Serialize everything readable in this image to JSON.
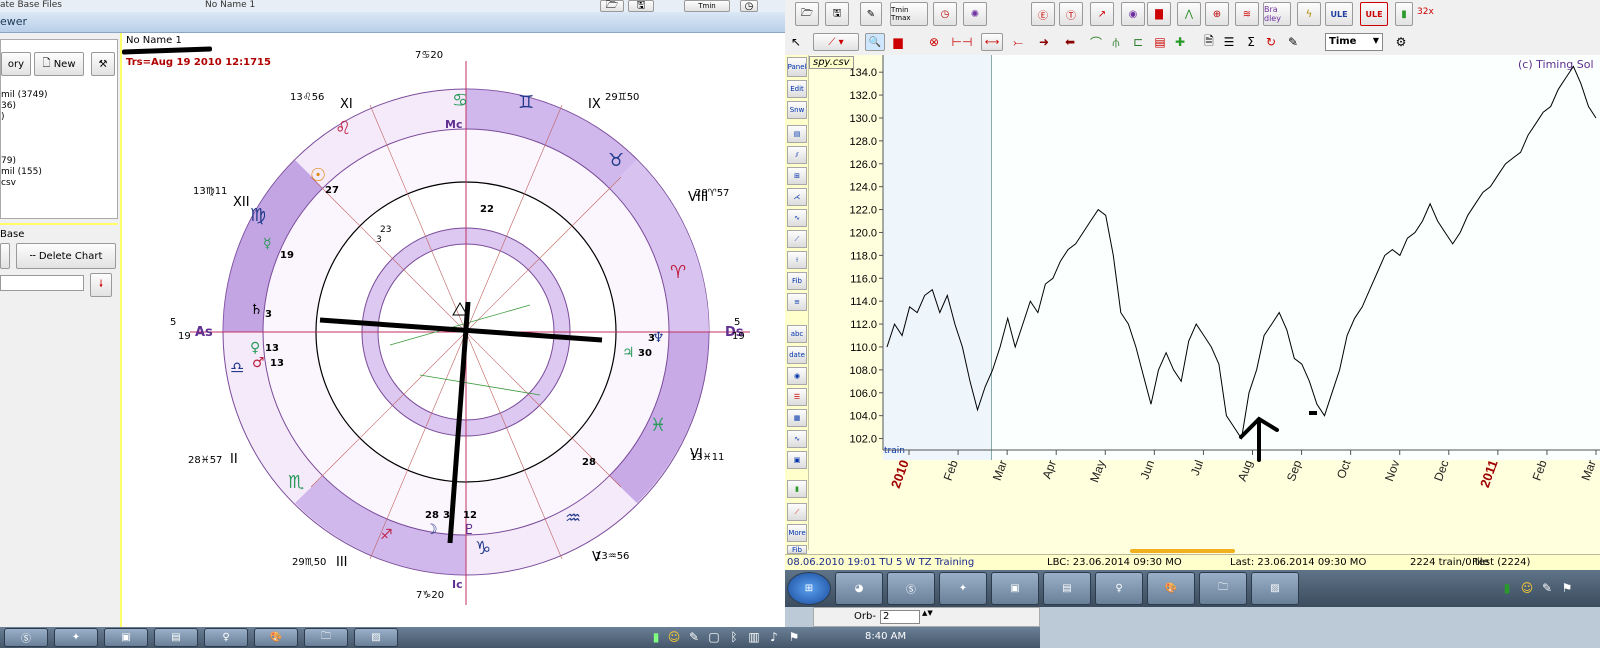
{
  "left_window": {
    "title_fragment": "ewer",
    "top_tabs": [
      "ate Base Files",
      "No Name 1"
    ],
    "panel": {
      "history_button": "ory",
      "new_button": "New",
      "list_items": [
        "mil (3749)",
        "36)",
        ")",
        "79)",
        "mil (155)",
        "csv"
      ],
      "base_label": "Base",
      "delete_button": "Delete Chart"
    },
    "chart_name": "No Name 1",
    "transit_label": "Trs=Aug 19 2010 12:1715"
  },
  "wheel": {
    "houses": [
      "XI",
      "IX",
      "XII",
      "VIII",
      "II",
      "VI",
      "III",
      "V"
    ],
    "axis_labels": {
      "mc": "Mc",
      "ic": "Ic",
      "as": "As",
      "ds": "Ds"
    },
    "degree_labels": [
      "7♋20",
      "13♌56",
      "29♊50",
      "13♍11",
      "28♈57",
      "5",
      "19",
      "5",
      "19",
      "28♓57",
      "13♓11",
      "29♏50",
      "13♒56",
      "7♑20"
    ],
    "planet_numbers": [
      "27",
      "19",
      "3",
      "13",
      "13",
      "30",
      "3",
      "28",
      "3",
      "12",
      "28",
      "22",
      "23",
      "3"
    ]
  },
  "right_app": {
    "time_select": "Time",
    "badges": [
      "ULE",
      "ULE",
      "32x",
      "Bra dley"
    ],
    "chart_title": "spy.csv",
    "copyright": "(c) Timing Sol",
    "train_label": "train",
    "sidebar_labels": [
      "Panel",
      "Edit",
      "Snw",
      "abc",
      "date",
      "More",
      "Fib"
    ],
    "status": {
      "left": "08.06.2010  19:01 TU  5 W TZ  Training",
      "lbc": "LBC: 23.06.2014  09:30 MO",
      "last": "Last: 23.06.2014  09:30 MO",
      "count": "2224 train/0 test (2224)",
      "file": "File"
    }
  },
  "taskbar": {
    "clock": "8:40 AM",
    "orb_label": "Orb-",
    "orb_value": "2"
  },
  "chart_data": {
    "type": "line",
    "yticks": [
      102.0,
      104.0,
      106.0,
      108.0,
      110.0,
      112.0,
      114.0,
      116.0,
      118.0,
      120.0,
      122.0,
      124.0,
      126.0,
      128.0,
      130.0,
      132.0,
      134.0
    ],
    "ylim": [
      101.0,
      135.5
    ],
    "x_labels": [
      "2010",
      "Feb",
      "Mar",
      "Apr",
      "May",
      "Jun",
      "Jul",
      "Aug",
      "Sep",
      "Oct",
      "Nov",
      "Dec",
      "2011",
      "Feb",
      "Mar"
    ],
    "year_labels": [
      "2010",
      "2011"
    ],
    "series": [
      {
        "values": [
          110,
          112,
          111,
          113.5,
          113,
          114.5,
          115,
          113,
          114.5,
          112,
          110,
          107,
          104.5,
          106.5,
          108,
          110,
          112.5,
          110,
          112,
          114,
          113,
          115.5,
          116,
          117.5,
          118.5,
          119,
          120,
          121,
          122,
          121.5,
          118,
          113,
          112,
          110,
          107.5,
          105,
          108,
          109.5,
          108,
          107,
          110.5,
          112,
          111,
          110,
          108.5,
          104,
          103,
          102,
          106,
          108,
          111,
          112,
          113,
          111.5,
          109,
          108.5,
          107,
          105,
          104,
          106,
          108,
          111,
          112.5,
          113.5,
          115,
          116.5,
          118,
          118.5,
          118,
          119.5,
          120,
          121,
          122.5,
          121,
          120,
          119,
          120,
          121.5,
          122.5,
          123.5,
          124,
          125,
          126,
          126.5,
          127,
          128.5,
          129.5,
          130.5,
          131,
          132.5,
          133.5,
          134.5,
          133,
          131,
          130
        ]
      }
    ]
  }
}
